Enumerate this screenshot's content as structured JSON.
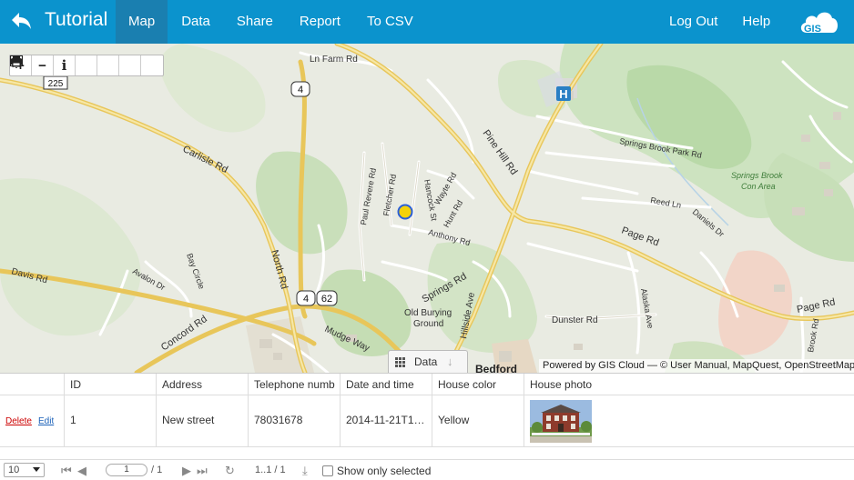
{
  "header": {
    "title": "Tutorial",
    "nav": [
      {
        "label": "Map",
        "active": true
      },
      {
        "label": "Data"
      },
      {
        "label": "Share"
      },
      {
        "label": "Report"
      },
      {
        "label": "To CSV"
      }
    ],
    "right_nav": [
      {
        "label": "Log Out"
      },
      {
        "label": "Help"
      }
    ],
    "logo_text": "GIS",
    "bar_color": "#0b93cd"
  },
  "map": {
    "toolbar": [
      "zoom-in-icon",
      "zoom-out-icon",
      "info-icon",
      "locate-icon",
      "globe-icon",
      "print-icon",
      "layers-icon"
    ],
    "data_tab_label": "Data",
    "attribution": "Powered by GIS Cloud — © User Manual, MapQuest, OpenStreetMap",
    "labels": {
      "ln_farm": "Ln Farm Rd",
      "shield_225": "225",
      "shield_4a": "4",
      "shield_4b": "4",
      "shield_62": "62",
      "carlisle": "Carlisle Rd",
      "pine_hill": "Pine Hill Rd",
      "springs_brook_park": "Springs Brook Park Rd",
      "springs_brook_con": "Springs Brook",
      "springs_brook_con2": "Con Area",
      "paul_revere": "Paul Revere Rd",
      "fletcher": "Fletcher Rd",
      "hancock": "Hancock St",
      "wayte": "Wayte Rd",
      "hunt": "Hunt Rd",
      "anthony": "Anthony Rd",
      "reed": "Reed Ln",
      "daniels": "Daniels Dr",
      "page1": "Page Rd",
      "page2": "Page Rd",
      "bay_circle": "Bay Circle",
      "avalon": "Avalon Dr",
      "davis": "Davis Rd",
      "north": "North Rd",
      "springs": "Springs Rd",
      "hillside": "Hillside Ave",
      "old_burying": "Old Burying",
      "ground": "Ground",
      "concord": "Concord Rd",
      "mudge": "Mudge Way",
      "dunster": "Dunster Rd",
      "alaska": "Alaska Ave",
      "brook": "Brook Rd",
      "bedford": "Bedford",
      "hospital": "H"
    }
  },
  "table": {
    "columns": [
      "ID",
      "Address",
      "Telephone numb",
      "Date and time",
      "House color",
      "House photo"
    ],
    "rows": [
      {
        "delete": "Delete",
        "edit": "Edit",
        "id": "1",
        "address": "New street",
        "telephone": "78031678",
        "datetime": "2014-11-21T1…",
        "color": "Yellow"
      }
    ]
  },
  "pager": {
    "page_size": "10",
    "page_input": "1",
    "page_total": "/ 1",
    "range": "1..1 / 1",
    "show_only_selected": "Show only selected"
  }
}
